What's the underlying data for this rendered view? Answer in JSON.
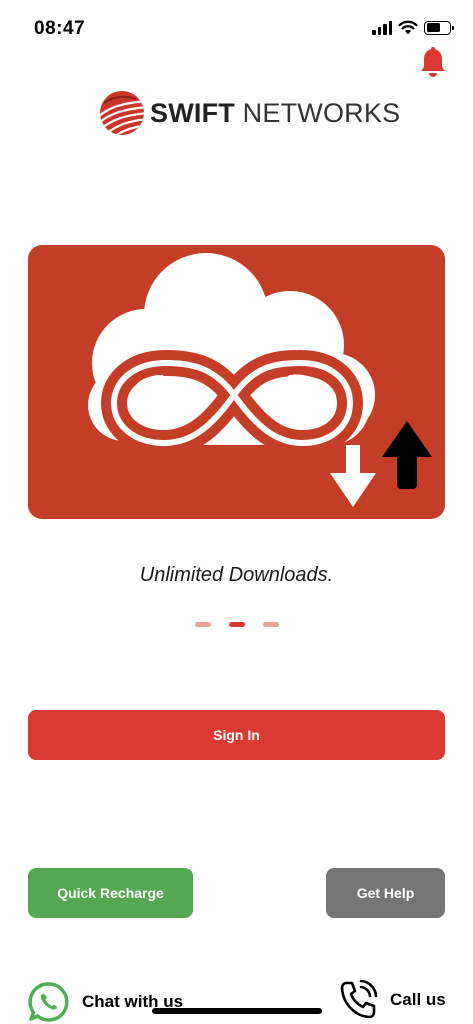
{
  "status_bar": {
    "time": "08:47"
  },
  "brand": {
    "name_bold": "SWIFT",
    "name_rest": " NETWORKS",
    "accent": "#db3a32"
  },
  "hero": {
    "caption": "Unlimited Downloads.",
    "background": "#c43d26"
  },
  "carousel": {
    "pages": 3,
    "active_index": 1
  },
  "actions": {
    "sign_in": "Sign In",
    "quick_recharge": "Quick Recharge",
    "get_help": "Get Help"
  },
  "footer": {
    "chat_label": "Chat with us",
    "call_label": "Call us",
    "chat_icon": "whatsapp-icon",
    "call_icon": "phone-icon"
  },
  "colors": {
    "sign_in": "#db3a32",
    "quick_recharge": "#55a851",
    "get_help": "#757575",
    "whatsapp": "#4caf50"
  }
}
